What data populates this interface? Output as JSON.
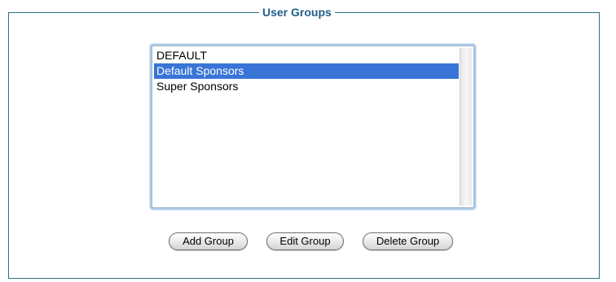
{
  "panel": {
    "title": "User Groups"
  },
  "groups_list": {
    "items": [
      "DEFAULT",
      "Default Sponsors",
      "Super Sponsors"
    ],
    "selected": "Default Sponsors"
  },
  "buttons": {
    "add": "Add Group",
    "edit": "Edit Group",
    "delete": "Delete Group"
  },
  "colors": {
    "selection": "#3875d7",
    "legend_text": "#1f5e8a",
    "border": "#2f6f84"
  }
}
